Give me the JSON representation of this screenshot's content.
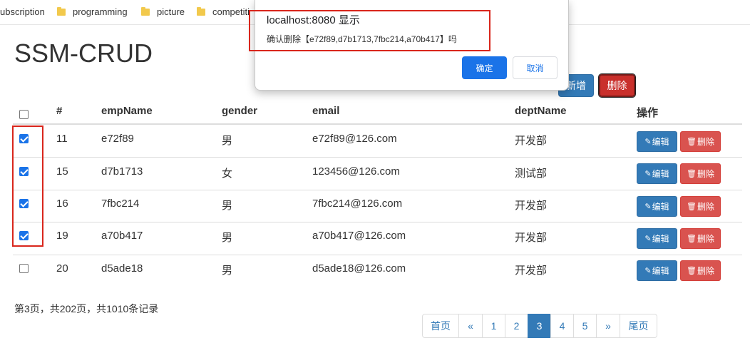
{
  "bookmarks": [
    {
      "label": "ubscription",
      "icon": "folder-icon"
    },
    {
      "label": "programming",
      "icon": "folder-icon"
    },
    {
      "label": "picture",
      "icon": "folder-icon"
    },
    {
      "label": "competiti",
      "icon": "folder-icon"
    }
  ],
  "page": {
    "title": "SSM-CRUD",
    "add_label": "新增",
    "delete_all_label": "删除"
  },
  "table": {
    "headers": [
      "#",
      "empName",
      "gender",
      "email",
      "deptName",
      "操作"
    ],
    "rows": [
      {
        "checked": true,
        "id": "11",
        "name": "e72f89",
        "gender": "男",
        "email": "e72f89@126.com",
        "dept": "开发部"
      },
      {
        "checked": true,
        "id": "15",
        "name": "d7b1713",
        "gender": "女",
        "email": "123456@126.com",
        "dept": "测试部"
      },
      {
        "checked": true,
        "id": "16",
        "name": "7fbc214",
        "gender": "男",
        "email": "7fbc214@126.com",
        "dept": "开发部"
      },
      {
        "checked": true,
        "id": "19",
        "name": "a70b417",
        "gender": "男",
        "email": "a70b417@126.com",
        "dept": "开发部"
      },
      {
        "checked": false,
        "id": "20",
        "name": "d5ade18",
        "gender": "男",
        "email": "d5ade18@126.com",
        "dept": "开发部"
      }
    ],
    "edit_label": "编辑",
    "delete_label": "删除"
  },
  "page_info": "第3页，共202页，共1010条记录",
  "pagination": {
    "first": "首页",
    "prev": "«",
    "pages": [
      "1",
      "2",
      "3",
      "4",
      "5"
    ],
    "active": "3",
    "next": "»",
    "last": "尾页"
  },
  "dialog": {
    "title": "localhost:8080 显示",
    "message": "确认删除【e72f89,d7b1713,7fbc214,a70b417】吗",
    "ok_label": "确定",
    "cancel_label": "取消"
  },
  "colors": {
    "primary": "#337ab7",
    "danger": "#d9534f",
    "highlight_box": "#d9261c",
    "dialog_button": "#1a73e8"
  }
}
